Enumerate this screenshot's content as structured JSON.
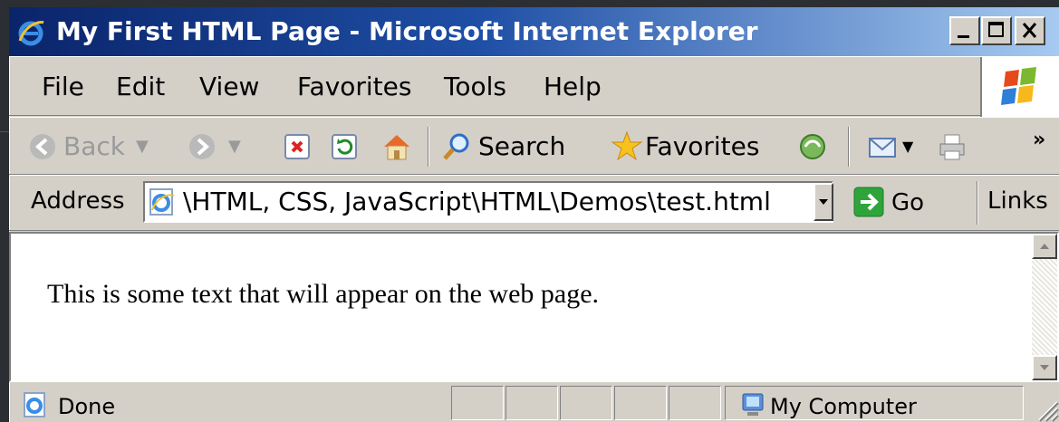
{
  "window": {
    "title": "My First HTML Page - Microsoft Internet Explorer",
    "controls": [
      "minimize",
      "maximize",
      "close"
    ]
  },
  "menu": {
    "items": [
      "File",
      "Edit",
      "View",
      "Favorites",
      "Tools",
      "Help"
    ]
  },
  "toolbar": {
    "back_label": "Back",
    "search_label": "Search",
    "favorites_label": "Favorites",
    "overflow_label": "»"
  },
  "address": {
    "label": "Address",
    "value": "\\HTML, CSS, JavaScript\\HTML\\Demos\\test.html",
    "go_label": "Go",
    "links_label": "Links"
  },
  "content": {
    "text": "This is some text that will appear on the web page."
  },
  "status": {
    "text": "Done",
    "zone": "My Computer"
  },
  "colors": {
    "title_start": "#0a246a",
    "title_end": "#a6caf0",
    "chrome": "#d4d0c8",
    "background": "#2b2f33"
  }
}
